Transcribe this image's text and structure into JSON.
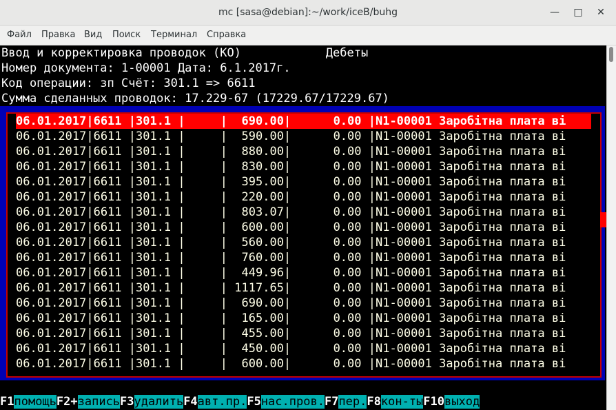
{
  "window": {
    "title": "mc [sasa@debian]:~/work/iceB/buhg"
  },
  "menu": [
    "Файл",
    "Правка",
    "Вид",
    "Поиск",
    "Терминал",
    "Справка"
  ],
  "header": {
    "line1": "Ввод и корректировка проводок (КО)            Дебеты",
    "line2": "Номер документа: 1-00001 Дата: 6.1.2017г.",
    "line3": "Код операции: зп Счёт: 301.1 => 6611",
    "line4": "Сумма сделанных проводок: 17.229-67 (17229.67/17229.67)"
  },
  "rows": [
    {
      "date": "06.01.2017",
      "debit": "6611",
      "credit": "301.1",
      "amount": "690.00",
      "amount2": "0.00",
      "comment": "N1-00001 Заробітна плата ві"
    },
    {
      "date": "06.01.2017",
      "debit": "6611",
      "credit": "301.1",
      "amount": "590.00",
      "amount2": "0.00",
      "comment": "N1-00001 Заробітна плата ві"
    },
    {
      "date": "06.01.2017",
      "debit": "6611",
      "credit": "301.1",
      "amount": "880.00",
      "amount2": "0.00",
      "comment": "N1-00001 Заробітна плата ві"
    },
    {
      "date": "06.01.2017",
      "debit": "6611",
      "credit": "301.1",
      "amount": "830.00",
      "amount2": "0.00",
      "comment": "N1-00001 Заробітна плата ві"
    },
    {
      "date": "06.01.2017",
      "debit": "6611",
      "credit": "301.1",
      "amount": "395.00",
      "amount2": "0.00",
      "comment": "N1-00001 Заробітна плата ві"
    },
    {
      "date": "06.01.2017",
      "debit": "6611",
      "credit": "301.1",
      "amount": "220.00",
      "amount2": "0.00",
      "comment": "N1-00001 Заробітна плата ві"
    },
    {
      "date": "06.01.2017",
      "debit": "6611",
      "credit": "301.1",
      "amount": "803.07",
      "amount2": "0.00",
      "comment": "N1-00001 Заробітна плата ві"
    },
    {
      "date": "06.01.2017",
      "debit": "6611",
      "credit": "301.1",
      "amount": "600.00",
      "amount2": "0.00",
      "comment": "N1-00001 Заробітна плата ві"
    },
    {
      "date": "06.01.2017",
      "debit": "6611",
      "credit": "301.1",
      "amount": "560.00",
      "amount2": "0.00",
      "comment": "N1-00001 Заробітна плата ві"
    },
    {
      "date": "06.01.2017",
      "debit": "6611",
      "credit": "301.1",
      "amount": "760.00",
      "amount2": "0.00",
      "comment": "N1-00001 Заробітна плата ві"
    },
    {
      "date": "06.01.2017",
      "debit": "6611",
      "credit": "301.1",
      "amount": "449.96",
      "amount2": "0.00",
      "comment": "N1-00001 Заробітна плата ві"
    },
    {
      "date": "06.01.2017",
      "debit": "6611",
      "credit": "301.1",
      "amount": "1117.65",
      "amount2": "0.00",
      "comment": "N1-00001 Заробітна плата ві"
    },
    {
      "date": "06.01.2017",
      "debit": "6611",
      "credit": "301.1",
      "amount": "690.00",
      "amount2": "0.00",
      "comment": "N1-00001 Заробітна плата ві"
    },
    {
      "date": "06.01.2017",
      "debit": "6611",
      "credit": "301.1",
      "amount": "165.00",
      "amount2": "0.00",
      "comment": "N1-00001 Заробітна плата ві"
    },
    {
      "date": "06.01.2017",
      "debit": "6611",
      "credit": "301.1",
      "amount": "455.00",
      "amount2": "0.00",
      "comment": "N1-00001 Заробітна плата ві"
    },
    {
      "date": "06.01.2017",
      "debit": "6611",
      "credit": "301.1",
      "amount": "450.00",
      "amount2": "0.00",
      "comment": "N1-00001 Заробітна плата ві"
    },
    {
      "date": "06.01.2017",
      "debit": "6611",
      "credit": "301.1",
      "amount": "600.00",
      "amount2": "0.00",
      "comment": "N1-00001 Заробітна плата ві"
    }
  ],
  "selected_row": 0,
  "fkeys": [
    {
      "key": "F1",
      "label": "помощь"
    },
    {
      "key": "F2+",
      "label": "запись"
    },
    {
      "key": "F3",
      "label": "удалить"
    },
    {
      "key": "F4",
      "label": "авт.пр."
    },
    {
      "key": "F5",
      "label": "нас.пров."
    },
    {
      "key": "F7",
      "label": "пер."
    },
    {
      "key": "F8",
      "label": "кон-ты"
    },
    {
      "key": "F10",
      "label": "выход"
    }
  ],
  "icons": {
    "minimize": "minimize-icon",
    "maximize": "maximize-icon",
    "close": "close-icon"
  }
}
